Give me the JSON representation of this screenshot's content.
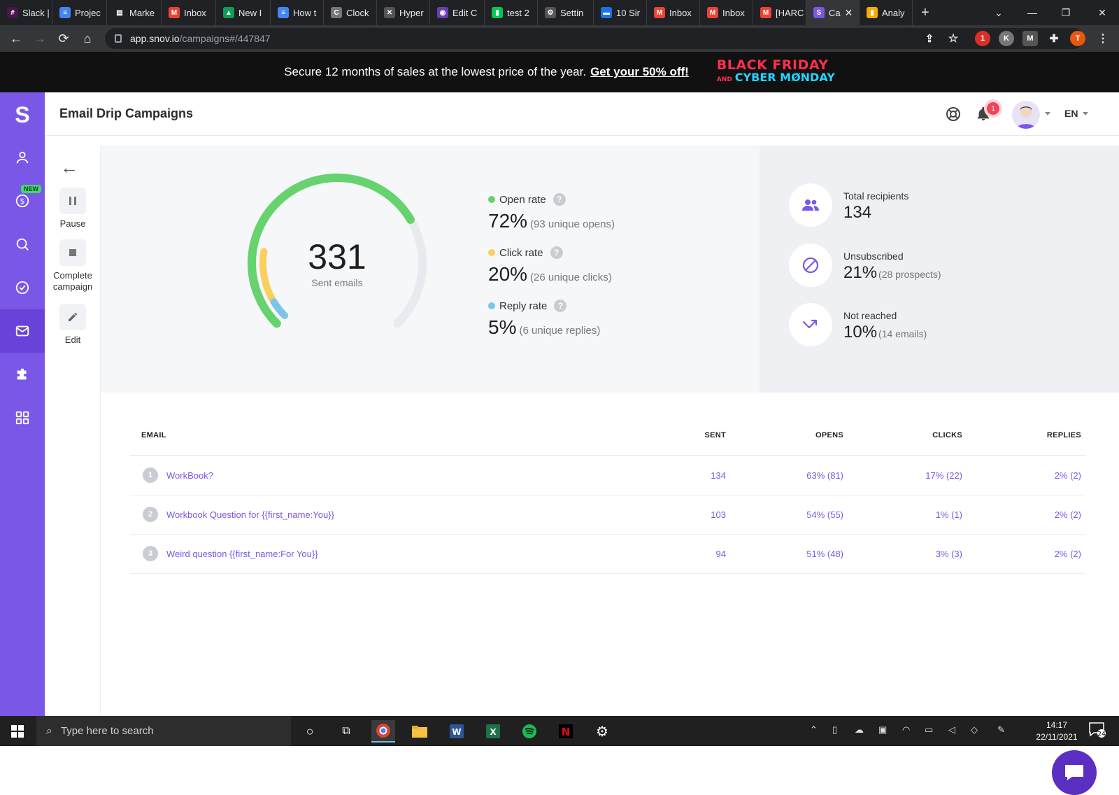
{
  "browser": {
    "tabs": [
      {
        "label": "Slack |",
        "color": "#4a154b",
        "glyph": "#"
      },
      {
        "label": "Projec",
        "color": "#4285f4",
        "glyph": "≡"
      },
      {
        "label": "Marke",
        "color": "#ffffff",
        "glyph": "▤"
      },
      {
        "label": "Inbox",
        "color": "#ea4335",
        "glyph": "M"
      },
      {
        "label": "New I",
        "color": "#0f9d58",
        "glyph": "▲"
      },
      {
        "label": "How t",
        "color": "#4285f4",
        "glyph": "≡"
      },
      {
        "label": "Clock",
        "color": "#777777",
        "glyph": "C"
      },
      {
        "label": "Hyper",
        "color": "#555555",
        "glyph": "✕"
      },
      {
        "label": "Edit C",
        "color": "#6a3fb5",
        "glyph": "◉"
      },
      {
        "label": "test 2",
        "color": "#00c853",
        "glyph": "▮"
      },
      {
        "label": "Settin",
        "color": "#555555",
        "glyph": "⚙"
      },
      {
        "label": "10 Sir",
        "color": "#1a73e8",
        "glyph": "▬"
      },
      {
        "label": "Inbox",
        "color": "#ea4335",
        "glyph": "M"
      },
      {
        "label": "Inbox",
        "color": "#ea4335",
        "glyph": "M"
      },
      {
        "label": "[HARC",
        "color": "#ea4335",
        "glyph": "M"
      },
      {
        "label": "Ca",
        "color": "#7b57e8",
        "glyph": "S",
        "active": true
      },
      {
        "label": "Analy",
        "color": "#f9ab00",
        "glyph": "▮"
      }
    ],
    "url_host": "app.snov.io",
    "url_path": "/campaigns#/447847",
    "extensions": {
      "ext1_badge": "1",
      "ext2": "K",
      "ext3": "M",
      "profile": "T"
    }
  },
  "promo": {
    "text": "Secure 12 months of sales at the lowest price of the year.",
    "link": "Get your 50% off!",
    "bf_line1": "BLACK FRIDAY",
    "bf_and": "AND",
    "bf_line2": "CYBER MØNDAY"
  },
  "app": {
    "logo": "S",
    "new_badge": "NEW",
    "page_title": "Email Drip Campaigns",
    "notification_count": "1",
    "language": "EN"
  },
  "actions": {
    "pause": "Pause",
    "complete_line1": "Complete",
    "complete_line2": "campaign",
    "edit": "Edit"
  },
  "stats": {
    "sent_count": "331",
    "sent_label": "Sent emails",
    "open_rate_label": "Open rate",
    "open_rate_value": "72%",
    "open_rate_detail": "(93 unique opens)",
    "click_rate_label": "Click rate",
    "click_rate_value": "20%",
    "click_rate_detail": "(26 unique clicks)",
    "reply_rate_label": "Reply rate",
    "reply_rate_value": "5%",
    "reply_rate_detail": "(6 unique replies)",
    "open_fraction": 0.72,
    "click_fraction": 0.2,
    "reply_fraction": 0.05,
    "colors": {
      "open": "#66d36e",
      "click": "#f9cf5f",
      "reply": "#7cc4ec",
      "track": "#e8eaef"
    }
  },
  "kpis": {
    "total_label": "Total recipients",
    "total_value": "134",
    "unsub_label": "Unsubscribed",
    "unsub_value": "21%",
    "unsub_detail": "(28 prospects)",
    "notreached_label": "Not reached",
    "notreached_value": "10%",
    "notreached_detail": "(14 emails)"
  },
  "table": {
    "headers": {
      "email": "EMAIL",
      "sent": "SENT",
      "opens": "OPENS",
      "clicks": "CLICKS",
      "replies": "REPLIES"
    },
    "rows": [
      {
        "n": "1",
        "subject": "WorkBook?",
        "sent": "134",
        "opens": "63% (81)",
        "clicks": "17% (22)",
        "replies": "2% (2)"
      },
      {
        "n": "2",
        "subject": "Workbook Question for {{first_name:You}}",
        "sent": "103",
        "opens": "54% (55)",
        "clicks": "1% (1)",
        "replies": "2% (2)"
      },
      {
        "n": "3",
        "subject": "Weird question {{first_name:For You}}",
        "sent": "94",
        "opens": "51% (48)",
        "clicks": "3% (3)",
        "replies": "2% (2)"
      }
    ]
  },
  "taskbar": {
    "search_placeholder": "Type here to search",
    "time": "14:17",
    "date": "22/11/2021",
    "notif_count": "24"
  }
}
